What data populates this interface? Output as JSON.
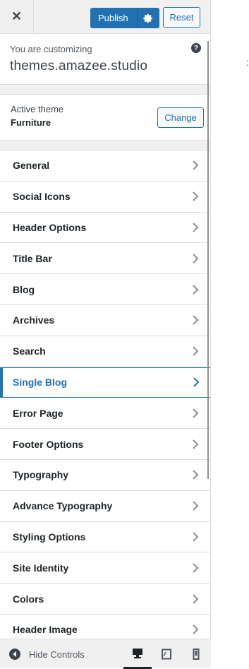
{
  "header": {
    "close_label": "✕",
    "publish_label": "Publish",
    "reset_label": "Reset"
  },
  "info": {
    "customizing_label": "You are customizing",
    "site_name": "themes.amazee.studio",
    "help_label": "?"
  },
  "theme": {
    "active_label": "Active theme",
    "theme_name": "Furniture",
    "change_label": "Change"
  },
  "menu": {
    "items": [
      {
        "label": "General"
      },
      {
        "label": "Social Icons"
      },
      {
        "label": "Header Options"
      },
      {
        "label": "Title Bar"
      },
      {
        "label": "Blog"
      },
      {
        "label": "Archives"
      },
      {
        "label": "Search"
      },
      {
        "label": "Single Blog",
        "active": true
      },
      {
        "label": "Error Page"
      },
      {
        "label": "Footer Options"
      },
      {
        "label": "Typography"
      },
      {
        "label": "Advance Typography"
      },
      {
        "label": "Styling Options"
      },
      {
        "label": "Site Identity"
      },
      {
        "label": "Colors"
      },
      {
        "label": "Header Image"
      }
    ]
  },
  "footer": {
    "hide_controls_label": "Hide Controls",
    "devices": [
      "desktop-icon",
      "tablet-icon",
      "mobile-icon"
    ],
    "selected_device": "desktop"
  },
  "preview": {
    "edge_mark": ":"
  },
  "colors": {
    "accent": "#2271b1",
    "panel_bg": "#f0f0f1"
  }
}
